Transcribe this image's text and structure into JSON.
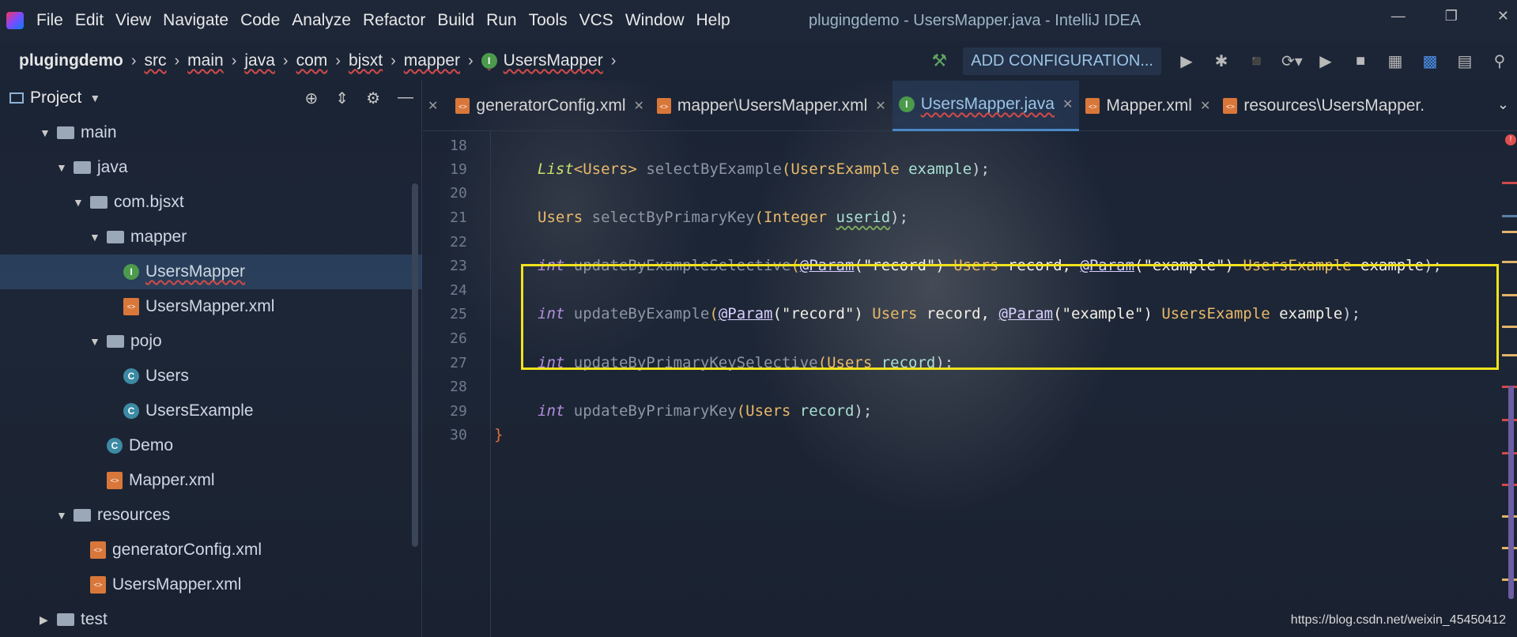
{
  "menubar": {
    "items": [
      "File",
      "Edit",
      "View",
      "Navigate",
      "Code",
      "Analyze",
      "Refactor",
      "Build",
      "Run",
      "Tools",
      "VCS",
      "Window",
      "Help"
    ],
    "window_title": "plugingdemo - UsersMapper.java - IntelliJ IDEA"
  },
  "navbar": {
    "breadcrumbs": [
      "plugingdemo",
      "src",
      "main",
      "java",
      "com",
      "bjsxt",
      "mapper",
      "UsersMapper"
    ],
    "add_configuration": "ADD CONFIGURATION..."
  },
  "project": {
    "title": "Project",
    "tree": [
      {
        "label": "main",
        "type": "folder",
        "depth": 0,
        "arrow": "down"
      },
      {
        "label": "java",
        "type": "folder",
        "depth": 1,
        "arrow": "down"
      },
      {
        "label": "com.bjsxt",
        "type": "package",
        "depth": 2,
        "arrow": "down"
      },
      {
        "label": "mapper",
        "type": "package",
        "depth": 3,
        "arrow": "down"
      },
      {
        "label": "UsersMapper",
        "type": "interface",
        "depth": 4,
        "selected": true
      },
      {
        "label": "UsersMapper.xml",
        "type": "xml",
        "depth": 4
      },
      {
        "label": "pojo",
        "type": "package",
        "depth": 3,
        "arrow": "down"
      },
      {
        "label": "Users",
        "type": "class",
        "depth": 4
      },
      {
        "label": "UsersExample",
        "type": "class",
        "depth": 4
      },
      {
        "label": "Demo",
        "type": "class",
        "depth": 3
      },
      {
        "label": "Mapper.xml",
        "type": "xml",
        "depth": 3
      },
      {
        "label": "resources",
        "type": "resfolder",
        "depth": 1,
        "arrow": "down"
      },
      {
        "label": "generatorConfig.xml",
        "type": "xml",
        "depth": 2
      },
      {
        "label": "UsersMapper.xml",
        "type": "xml",
        "depth": 2
      },
      {
        "label": "test",
        "type": "folder",
        "depth": 0,
        "arrow": "right"
      }
    ]
  },
  "tabs": [
    {
      "label": "generatorConfig.xml",
      "icon": "xml"
    },
    {
      "label": "mapper\\UsersMapper.xml",
      "icon": "xml"
    },
    {
      "label": "UsersMapper.java",
      "icon": "interface",
      "active": true
    },
    {
      "label": "Mapper.xml",
      "icon": "xml"
    },
    {
      "label": "resources\\UsersMapper.",
      "icon": "xml"
    }
  ],
  "editor": {
    "line_numbers": [
      "18",
      "19",
      "20",
      "21",
      "22",
      "23",
      "24",
      "25",
      "26",
      "27",
      "28",
      "29",
      "30"
    ],
    "lines": {
      "l19": {
        "a": "List",
        "b": "<",
        "c": "Users",
        "d": ">",
        "e": " selectByExample",
        "f": "(",
        "g": "UsersExample",
        "h": " example",
        "i": ");"
      },
      "l21": {
        "a": "Users",
        "b": " selectByPrimaryKey",
        "c": "(",
        "d": "Integer",
        "e": " ",
        "f": "userid",
        "g": ");"
      },
      "l23": {
        "a": "int",
        "b": " updateByExampleSelective",
        "c": "(",
        "d": "@Param",
        "e": "(\"record\")",
        "f": " Users",
        "g": " record, ",
        "h": "@Param",
        "i": "(\"example\")",
        "j": " UsersExample",
        "k": " example",
        "l": ");"
      },
      "l25": {
        "a": "int",
        "b": " updateByExample",
        "c": "(",
        "d": "@Param",
        "e": "(\"record\")",
        "f": " Users",
        "g": " record, ",
        "h": "@Param",
        "i": "(\"example\")",
        "j": " UsersExample",
        "k": " example",
        "l": ");"
      },
      "l27": {
        "a": "int",
        "b": " updateByPrimaryKeySelective",
        "c": "(",
        "d": "Users",
        "e": " record",
        "f": ");"
      },
      "l29": {
        "a": "int",
        "b": " updateByPrimaryKey",
        "c": "(",
        "d": "Users",
        "e": " record",
        "f": ");"
      },
      "l30": {
        "a": "}"
      }
    }
  },
  "watermark": "https://blog.csdn.net/weixin_45450412",
  "colors": {
    "highlight_box": "#f2e21c",
    "keyword": "#b48fe0",
    "type": "#e8b96a"
  }
}
